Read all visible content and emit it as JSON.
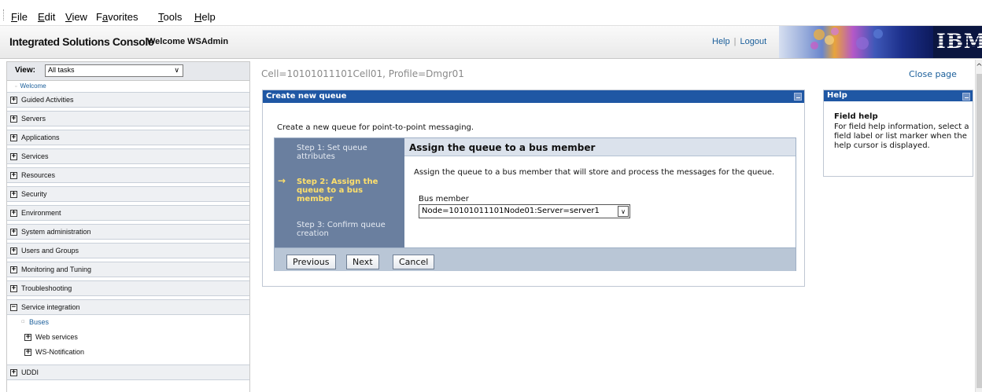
{
  "menubar": {
    "items": [
      {
        "label": "File",
        "u": "F",
        "rest": "ile"
      },
      {
        "label": "Edit",
        "u": "E",
        "rest": "dit"
      },
      {
        "label": "View",
        "u": "V",
        "rest": "iew"
      },
      {
        "label": "Favorites",
        "u": "a",
        "pre": "F",
        "rest": "vorites"
      },
      {
        "label": "Tools",
        "u": "T",
        "rest": "ools"
      },
      {
        "label": "Help",
        "u": "H",
        "rest": "elp"
      }
    ]
  },
  "banner": {
    "title": "Integrated Solutions Console",
    "welcome": "Welcome WSAdmin",
    "help_link": "Help",
    "separator": "|",
    "logout_link": "Logout",
    "logo": "IBM"
  },
  "nav": {
    "view_label": "View:",
    "view_value": "All tasks",
    "welcome": "Welcome",
    "categories": [
      "Guided Activities",
      "Servers",
      "Applications",
      "Services",
      "Resources",
      "Security",
      "Environment",
      "System administration",
      "Users and Groups",
      "Monitoring and Tuning",
      "Troubleshooting"
    ],
    "expanded": {
      "label": "Service integration",
      "children": [
        "Buses",
        "Web services",
        "WS-Notification"
      ]
    },
    "last": "UDDI"
  },
  "main": {
    "breadcrumb": "Cell=10101011101Cell01, Profile=Dmgr01",
    "close_page": "Close page",
    "portlet_title": "Create new queue",
    "intro": "Create a new queue for point-to-point messaging.",
    "steps": [
      "Step 1: Set queue attributes",
      "Step 2: Assign the queue to a bus member",
      "Step 3: Confirm queue creation"
    ],
    "current_arrow": "→",
    "content_title": "Assign the queue to a bus member",
    "content_desc": "Assign the queue to a bus member that will store and process the messages for the queue.",
    "field_label": "Bus member",
    "field_value": "Node=10101011101Node01:Server=server1",
    "buttons": {
      "previous": "Previous",
      "next": "Next",
      "cancel": "Cancel"
    }
  },
  "help": {
    "header": "Help",
    "title": "Field help",
    "body": "For field help information, select a field label or list marker when the help cursor is displayed."
  },
  "colors": {
    "accent": "#1f57a4",
    "link": "#1a5e9a",
    "wizard_steps": "#6a7f9f",
    "current_step": "#ffe06b"
  }
}
